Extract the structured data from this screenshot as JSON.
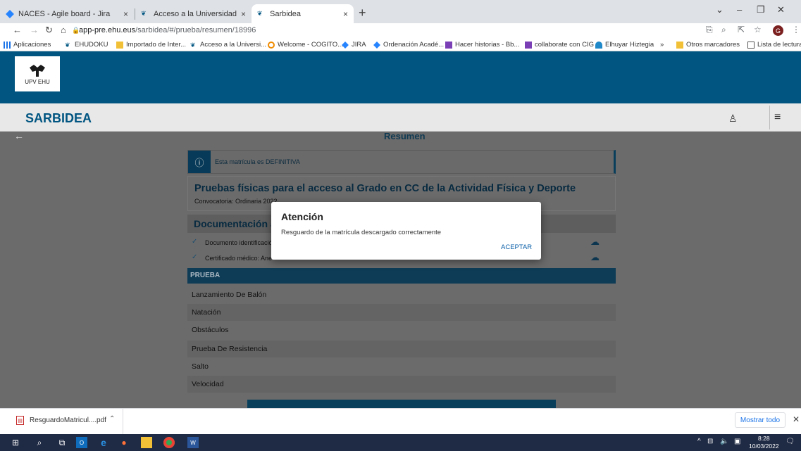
{
  "browser": {
    "tabs": [
      {
        "title": "NACES - Agile board - Jira"
      },
      {
        "title": "Acceso a la Universidad - UPV/E"
      },
      {
        "title": "Sarbidea"
      }
    ],
    "new_tab": "+",
    "address": {
      "host": "app-pre.ehu.eus",
      "path": "/sarbidea/#/prueba/resumen/18996"
    },
    "profile_initial": "G",
    "bookmarks": [
      "Aplicaciones",
      "EHUDOKU",
      "Importado de Inter...",
      "Acceso a la Universi...",
      "Welcome - COGITO...",
      "JIRA",
      "Ordenación Acadé...",
      "Hacer historias - Bb...",
      "collaborate con CIG",
      "Elhuyar Hiztegia",
      "»",
      "Otros marcadores",
      "Lista de lectura"
    ]
  },
  "site": {
    "logo_text": "UPV  EHU",
    "brand": "SARBIDEA",
    "user_icon": "user-icon",
    "menu_icon": "hamburger-icon"
  },
  "page": {
    "title": "Resumen",
    "notice": "Esta matrícula es DEFINITIVA",
    "course_title": "Pruebas físicas para el acceso al Grado en CC de la Actividad Física y Deporte",
    "convocatoria": "Convocatoria: Ordinaria 2022",
    "documentation_heading": "Documentación a",
    "documents": [
      {
        "label": "Documento identificació"
      },
      {
        "label": "Certificado médico: Ane"
      }
    ],
    "prueba_header": "PRUEBA",
    "pruebas": [
      "Lanzamiento De Balón",
      "Natación",
      "Obstáculos",
      "Prueba De Resistencia",
      "Salto",
      "Velocidad"
    ]
  },
  "modal": {
    "title": "Atención",
    "message": "Resguardo de la matrícula descargado correctamente",
    "button": "ACEPTAR"
  },
  "downloads": {
    "file": "ResguardoMatricul....pdf",
    "show_all": "Mostrar todo"
  },
  "taskbar": {
    "time": "8:28",
    "date": "10/03/2022"
  }
}
